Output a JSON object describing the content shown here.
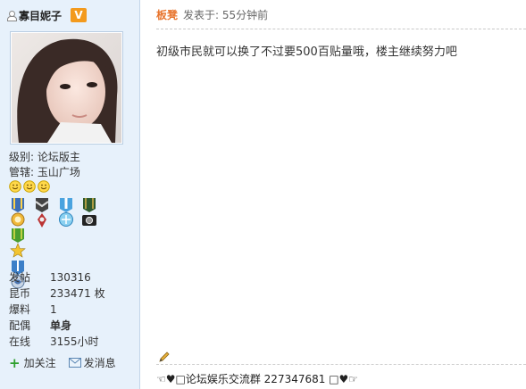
{
  "user": {
    "name": "寡目妮子",
    "badge": "V",
    "level_label": "级别:",
    "level_value": "论坛版主",
    "manage_label": "管辖:",
    "manage_value": "玉山广场"
  },
  "stats": [
    {
      "key": "发帖",
      "value": "130316"
    },
    {
      "key": "昆币",
      "value": "233471 枚"
    },
    {
      "key": "爆料",
      "value": "1"
    },
    {
      "key": "配偶",
      "value": "单身"
    },
    {
      "key": "在线",
      "value": "3155小时"
    }
  ],
  "actions": {
    "follow": "加关注",
    "message": "发消息"
  },
  "post": {
    "author": "板凳",
    "posted": "发表于: 55分钟前",
    "content": "初级市民就可以换了不过要500百贴量哦，楼主继续努力吧",
    "signature": "☜♥□论坛娱乐交流群 227347681 □♥☞"
  },
  "colors": {
    "sidebar_bg": "#e7f1fb",
    "author": "#e8742d",
    "v_badge": "#f39a1d"
  }
}
